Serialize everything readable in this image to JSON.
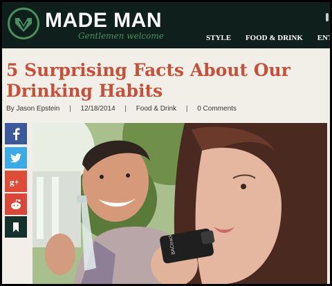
{
  "header": {
    "brand": "MADE MAN",
    "tagline": "Gentlemen welcome",
    "nav": [
      "STYLE",
      "FOOD & DRINK",
      "ENTERTA"
    ]
  },
  "article": {
    "title": "5 Surprising Facts About Our Drinking Habits",
    "byline": {
      "prefix": "By",
      "author": "Jason Epstein",
      "date": "12/18/2014",
      "category": "Food & Drink",
      "comments": "0 Comments"
    },
    "hero_device_label": "BACtrack"
  },
  "share": [
    {
      "icon": "facebook-icon",
      "color": "#3b5998"
    },
    {
      "icon": "twitter-icon",
      "color": "#3da9e6"
    },
    {
      "icon": "google-plus-icon",
      "color": "#dd4b39"
    },
    {
      "icon": "reddit-icon",
      "color": "#d9473a"
    },
    {
      "icon": "bookmark-icon",
      "color": "#16302b"
    }
  ],
  "colors": {
    "header_bg": "#0f1f1c",
    "accent_green": "#4c8f5e",
    "title_red": "#c6503a",
    "page_bg": "#f2efe8"
  }
}
